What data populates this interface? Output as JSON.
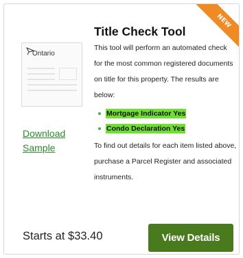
{
  "card": {
    "badge": "NEW",
    "title": "Title Check Tool",
    "description": "This tool will perform an automated check for the most common registered documents on title for this property. The results are below:",
    "results": [
      "Mortgage Indicator Yes",
      "Condo Declaration Yes"
    ],
    "note": "To find out details for each item listed above, purchase a Parcel Register and associated instruments.",
    "thumbnail_logo_text": "Ontario",
    "download_label": "Download Sample",
    "price_label": "Starts at $33.40",
    "button_label": "View Details"
  },
  "colors": {
    "accent_green": "#4a7a1e",
    "link_green": "#2b8a2b",
    "highlight": "#6fe02f",
    "ribbon": "#f08a24"
  },
  "icons": {
    "thumbnail_logo": "ontario-trillium-icon"
  }
}
